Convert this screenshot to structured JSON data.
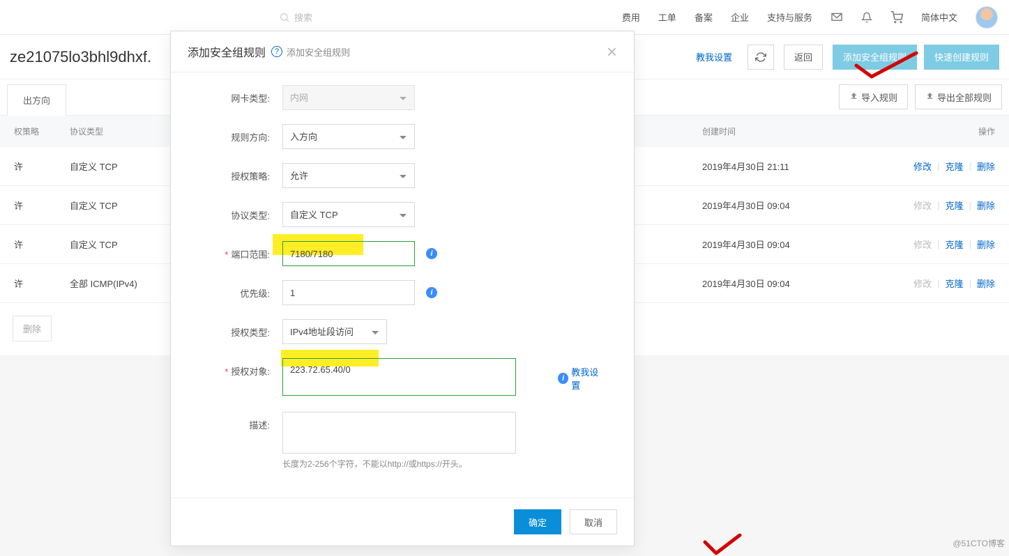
{
  "topbar": {
    "search_placeholder": "搜索",
    "links": [
      "费用",
      "工单",
      "备案",
      "企业",
      "支持与服务"
    ],
    "lang": "简体中文"
  },
  "page": {
    "instance_id": "ze21075lo3bhl9dhxf.",
    "teach_me": "教我设置",
    "back": "返回",
    "add_rule": "添加安全组规则",
    "quick_rule": "快速创建规则",
    "tab_out": "出方向",
    "import_rule": "导入规则",
    "export_rule": "导出全部规则"
  },
  "table": {
    "headers": {
      "policy": "权策略",
      "protocol": "协议类型",
      "created": "创建时间",
      "actions": "操作"
    },
    "rows": [
      {
        "policy": "许",
        "protocol": "自定义 TCP",
        "created": "2019年4月30日 21:11",
        "edit_disabled": false
      },
      {
        "policy": "许",
        "protocol": "自定义 TCP",
        "created": "2019年4月30日 09:04",
        "edit_disabled": true
      },
      {
        "policy": "许",
        "protocol": "自定义 TCP",
        "created": "2019年4月30日 09:04",
        "edit_disabled": true
      },
      {
        "policy": "许",
        "protocol": "全部 ICMP(IPv4)",
        "created": "2019年4月30日 09:04",
        "edit_disabled": true
      }
    ],
    "action_labels": {
      "edit": "修改",
      "clone": "克隆",
      "delete": "删除"
    },
    "bulk_delete": "删除"
  },
  "modal": {
    "title": "添加安全组规则",
    "subtitle": "添加安全组规则",
    "labels": {
      "nic": "网卡类型:",
      "direction": "规则方向:",
      "policy": "授权策略:",
      "protocol": "协议类型:",
      "port": "端口范围:",
      "priority": "优先级:",
      "auth_type": "授权类型:",
      "auth_obj": "授权对象:",
      "desc": "描述:"
    },
    "values": {
      "nic": "内网",
      "direction": "入方向",
      "policy": "允许",
      "protocol": "自定义 TCP",
      "port": "7180/7180",
      "priority": "1",
      "auth_type": "IPv4地址段访问",
      "auth_obj": "223.72.65.40/0",
      "desc": ""
    },
    "teach_me": "教我设置",
    "desc_hint": "长度为2-256个字符，不能以http://或https://开头。",
    "ok": "确定",
    "cancel": "取消"
  },
  "watermark": "@51CTO博客"
}
